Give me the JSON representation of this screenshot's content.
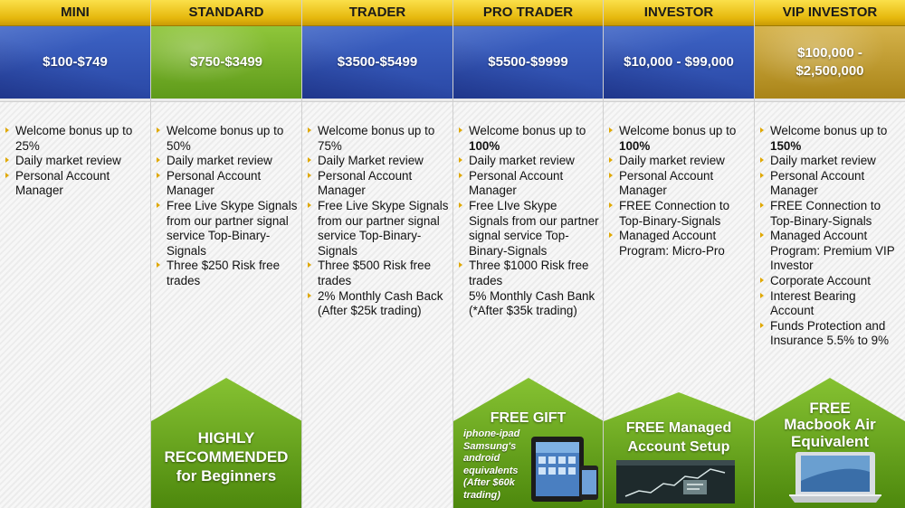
{
  "plans": [
    {
      "name": "MINI",
      "range": "$100-$749",
      "band": "blue",
      "features": [
        {
          "text": "Welcome bonus up to 25%",
          "bold": ""
        },
        {
          "text": "Daily market review",
          "bold": ""
        },
        {
          "text": "Personal Account Manager",
          "bold": ""
        }
      ]
    },
    {
      "name": "STANDARD",
      "range": "$750-$3499",
      "band": "green",
      "features": [
        {
          "text": "Welcome bonus up to 50%"
        },
        {
          "text": "Daily market review"
        },
        {
          "text": "Personal Account Manager"
        },
        {
          "text": "Free Live Skype Signals from our partner signal service Top-Binary-Signals"
        },
        {
          "text": "Three $250 Risk free trades"
        }
      ],
      "promo": {
        "line1": "HIGHLY",
        "line2": "RECOMMENDED",
        "line3": "for Beginners"
      }
    },
    {
      "name": "TRADER",
      "range": "$3500-$5499",
      "band": "blue",
      "features": [
        {
          "text": "Welcome bonus up to 75%"
        },
        {
          "text": "Daily Market review"
        },
        {
          "text": "Personal Account Manager"
        },
        {
          "text": "Free Live Skype Signals from our partner signal service Top-Binary-Signals"
        },
        {
          "text": "Three $500 Risk free trades"
        },
        {
          "text": "2% Monthly Cash Back (After $25k trading)"
        }
      ]
    },
    {
      "name": "PRO TRADER",
      "range": "$5500-$9999",
      "band": "blue",
      "features": [
        {
          "prefix": "Welcome bonus up to",
          "bold": "100%"
        },
        {
          "text": "Daily market review"
        },
        {
          "text": "Personal Account Manager"
        },
        {
          "text": "Free LIve Skype Signals from our partner signal service Top-Binary-Signals"
        },
        {
          "text": "Three $1000 Risk free trades"
        },
        {
          "text": "5% Monthly Cash Bank (*After $35k trading)",
          "noarrow": true
        }
      ],
      "promo": {
        "title": "FREE GIFT",
        "desc": "iphone-ipad Samsung's android equivalents (After $60k trading)"
      }
    },
    {
      "name": "INVESTOR",
      "range": "$10,000 - $99,000",
      "band": "blue",
      "features": [
        {
          "prefix": "Welcome bonus up to",
          "bold": "100%"
        },
        {
          "text": "Daily market review"
        },
        {
          "text": "Personal Account Manager"
        },
        {
          "text": "FREE Connection to Top-Binary-Signals"
        },
        {
          "text": "Managed Account Program: Micro-Pro"
        }
      ],
      "promo": {
        "title": "FREE Managed Account Setup"
      }
    },
    {
      "name": "VIP INVESTOR",
      "range": "$100,000 - $2,500,000",
      "band": "gold",
      "features": [
        {
          "prefix": "Welcome bonus up to",
          "bold": "150%"
        },
        {
          "text": "Daily market review"
        },
        {
          "text": "Personal Account Manager"
        },
        {
          "text": "FREE Connection to Top-Binary-Signals"
        },
        {
          "text": "Managed Account Program: Premium VIP Investor"
        },
        {
          "text": "Corporate Account"
        },
        {
          "text": "Interest Bearing Account"
        },
        {
          "text": "Funds Protection and Insurance 5.5% to 9%"
        }
      ],
      "promo": {
        "line1": "FREE",
        "line2": "Macbook Air",
        "line3": "Equivalent"
      }
    }
  ],
  "display": {
    "mini_range": "$100-$749",
    "standard_range": "$750-$3499",
    "trader_range": "$3500-$5499",
    "pro_range": "$5500-$9999",
    "investor_range": "$10,000 - $99,000",
    "vip_range_1": "$100,000 -",
    "vip_range_2": "$2,500,000"
  },
  "colors": {
    "header_gold": "#e6b90e",
    "band_blue": "#2f4fb0",
    "band_green": "#6aa821",
    "band_gold": "#bd9a2e",
    "promo_green": "#5e9a1a",
    "bullet": "#e0a800"
  },
  "icons": {
    "tablet": "tablet-phone-icon",
    "chart": "trading-chart-icon",
    "laptop": "laptop-icon"
  }
}
